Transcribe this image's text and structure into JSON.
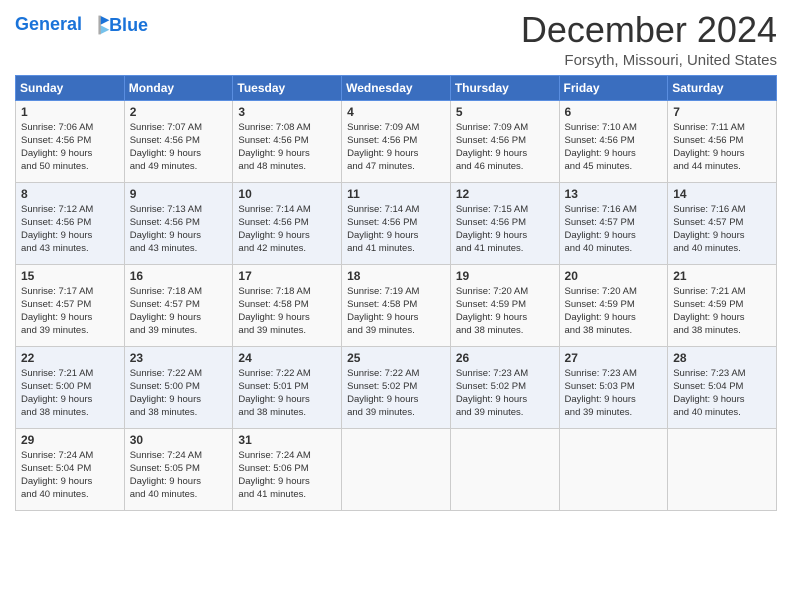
{
  "header": {
    "logo_line1": "General",
    "logo_line2": "Blue",
    "month": "December 2024",
    "location": "Forsyth, Missouri, United States"
  },
  "weekdays": [
    "Sunday",
    "Monday",
    "Tuesday",
    "Wednesday",
    "Thursday",
    "Friday",
    "Saturday"
  ],
  "weeks": [
    [
      {
        "day": "1",
        "info": "Sunrise: 7:06 AM\nSunset: 4:56 PM\nDaylight: 9 hours\nand 50 minutes."
      },
      {
        "day": "2",
        "info": "Sunrise: 7:07 AM\nSunset: 4:56 PM\nDaylight: 9 hours\nand 49 minutes."
      },
      {
        "day": "3",
        "info": "Sunrise: 7:08 AM\nSunset: 4:56 PM\nDaylight: 9 hours\nand 48 minutes."
      },
      {
        "day": "4",
        "info": "Sunrise: 7:09 AM\nSunset: 4:56 PM\nDaylight: 9 hours\nand 47 minutes."
      },
      {
        "day": "5",
        "info": "Sunrise: 7:09 AM\nSunset: 4:56 PM\nDaylight: 9 hours\nand 46 minutes."
      },
      {
        "day": "6",
        "info": "Sunrise: 7:10 AM\nSunset: 4:56 PM\nDaylight: 9 hours\nand 45 minutes."
      },
      {
        "day": "7",
        "info": "Sunrise: 7:11 AM\nSunset: 4:56 PM\nDaylight: 9 hours\nand 44 minutes."
      }
    ],
    [
      {
        "day": "8",
        "info": "Sunrise: 7:12 AM\nSunset: 4:56 PM\nDaylight: 9 hours\nand 43 minutes."
      },
      {
        "day": "9",
        "info": "Sunrise: 7:13 AM\nSunset: 4:56 PM\nDaylight: 9 hours\nand 43 minutes."
      },
      {
        "day": "10",
        "info": "Sunrise: 7:14 AM\nSunset: 4:56 PM\nDaylight: 9 hours\nand 42 minutes."
      },
      {
        "day": "11",
        "info": "Sunrise: 7:14 AM\nSunset: 4:56 PM\nDaylight: 9 hours\nand 41 minutes."
      },
      {
        "day": "12",
        "info": "Sunrise: 7:15 AM\nSunset: 4:56 PM\nDaylight: 9 hours\nand 41 minutes."
      },
      {
        "day": "13",
        "info": "Sunrise: 7:16 AM\nSunset: 4:57 PM\nDaylight: 9 hours\nand 40 minutes."
      },
      {
        "day": "14",
        "info": "Sunrise: 7:16 AM\nSunset: 4:57 PM\nDaylight: 9 hours\nand 40 minutes."
      }
    ],
    [
      {
        "day": "15",
        "info": "Sunrise: 7:17 AM\nSunset: 4:57 PM\nDaylight: 9 hours\nand 39 minutes."
      },
      {
        "day": "16",
        "info": "Sunrise: 7:18 AM\nSunset: 4:57 PM\nDaylight: 9 hours\nand 39 minutes."
      },
      {
        "day": "17",
        "info": "Sunrise: 7:18 AM\nSunset: 4:58 PM\nDaylight: 9 hours\nand 39 minutes."
      },
      {
        "day": "18",
        "info": "Sunrise: 7:19 AM\nSunset: 4:58 PM\nDaylight: 9 hours\nand 39 minutes."
      },
      {
        "day": "19",
        "info": "Sunrise: 7:20 AM\nSunset: 4:59 PM\nDaylight: 9 hours\nand 38 minutes."
      },
      {
        "day": "20",
        "info": "Sunrise: 7:20 AM\nSunset: 4:59 PM\nDaylight: 9 hours\nand 38 minutes."
      },
      {
        "day": "21",
        "info": "Sunrise: 7:21 AM\nSunset: 4:59 PM\nDaylight: 9 hours\nand 38 minutes."
      }
    ],
    [
      {
        "day": "22",
        "info": "Sunrise: 7:21 AM\nSunset: 5:00 PM\nDaylight: 9 hours\nand 38 minutes."
      },
      {
        "day": "23",
        "info": "Sunrise: 7:22 AM\nSunset: 5:00 PM\nDaylight: 9 hours\nand 38 minutes."
      },
      {
        "day": "24",
        "info": "Sunrise: 7:22 AM\nSunset: 5:01 PM\nDaylight: 9 hours\nand 38 minutes."
      },
      {
        "day": "25",
        "info": "Sunrise: 7:22 AM\nSunset: 5:02 PM\nDaylight: 9 hours\nand 39 minutes."
      },
      {
        "day": "26",
        "info": "Sunrise: 7:23 AM\nSunset: 5:02 PM\nDaylight: 9 hours\nand 39 minutes."
      },
      {
        "day": "27",
        "info": "Sunrise: 7:23 AM\nSunset: 5:03 PM\nDaylight: 9 hours\nand 39 minutes."
      },
      {
        "day": "28",
        "info": "Sunrise: 7:23 AM\nSunset: 5:04 PM\nDaylight: 9 hours\nand 40 minutes."
      }
    ],
    [
      {
        "day": "29",
        "info": "Sunrise: 7:24 AM\nSunset: 5:04 PM\nDaylight: 9 hours\nand 40 minutes."
      },
      {
        "day": "30",
        "info": "Sunrise: 7:24 AM\nSunset: 5:05 PM\nDaylight: 9 hours\nand 40 minutes."
      },
      {
        "day": "31",
        "info": "Sunrise: 7:24 AM\nSunset: 5:06 PM\nDaylight: 9 hours\nand 41 minutes."
      },
      {
        "day": "",
        "info": ""
      },
      {
        "day": "",
        "info": ""
      },
      {
        "day": "",
        "info": ""
      },
      {
        "day": "",
        "info": ""
      }
    ]
  ]
}
